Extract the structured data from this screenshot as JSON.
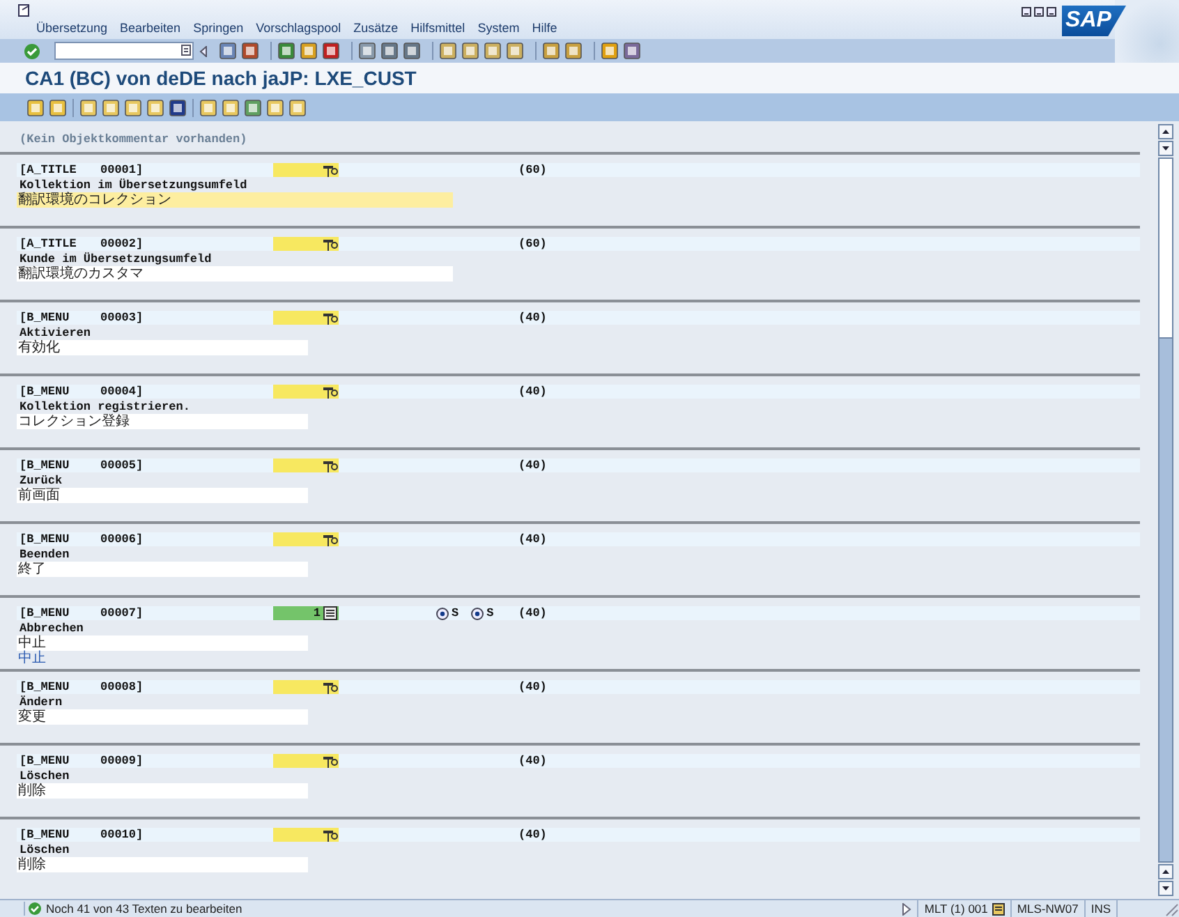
{
  "menu": [
    {
      "label": "Übersetzung"
    },
    {
      "label": "Bearbeiten"
    },
    {
      "label": "Springen"
    },
    {
      "label": "Vorschlagspool"
    },
    {
      "label": "Zusätze"
    },
    {
      "label": "Hilfsmittel"
    },
    {
      "label": "System"
    },
    {
      "label": "Hilfe"
    }
  ],
  "logo": "SAP",
  "title": "CA1 (BC) von deDE nach jaJP: LXE_CUST",
  "object_comment": "(Kein Objektkommentar vorhanden)",
  "entries": [
    {
      "object_type": "[A_TITLE",
      "number": "00001]",
      "length": "(60)",
      "source": "Kollektion im Übersetzungsumfeld",
      "target": "翻訳環境のコレクション",
      "kind": "wide",
      "focused": true
    },
    {
      "object_type": "[A_TITLE",
      "number": "00002]",
      "length": "(60)",
      "source": "Kunde im Übersetzungsumfeld",
      "target": "翻訳環境のカスタマ",
      "kind": "wide",
      "focused": false
    },
    {
      "object_type": "[B_MENU",
      "number": "00003]",
      "length": "(40)",
      "source": "Aktivieren",
      "target": "有効化",
      "kind": "narrow",
      "focused": false
    },
    {
      "object_type": "[B_MENU",
      "number": "00004]",
      "length": "(40)",
      "source": "Kollektion registrieren.",
      "target": "コレクション登録",
      "kind": "narrow",
      "focused": false
    },
    {
      "object_type": "[B_MENU",
      "number": "00005]",
      "length": "(40)",
      "source": "Zurück",
      "target": "前画面",
      "kind": "narrow",
      "focused": false
    },
    {
      "object_type": "[B_MENU",
      "number": "00006]",
      "length": "(40)",
      "source": "Beenden",
      "target": "終了",
      "kind": "narrow",
      "focused": false
    },
    {
      "object_type": "[B_MENU",
      "number": "00007]",
      "length": "(40)",
      "source": "Abbrechen",
      "target": "中止",
      "kind": "narrow",
      "focused": false,
      "proposal_count": "1",
      "options": [
        {
          "label": "S",
          "selected": true
        },
        {
          "label": "S",
          "selected": true
        }
      ],
      "proposal": "中止"
    },
    {
      "object_type": "[B_MENU",
      "number": "00008]",
      "length": "(40)",
      "source": "Ändern",
      "target": "変更",
      "kind": "narrow",
      "focused": false
    },
    {
      "object_type": "[B_MENU",
      "number": "00009]",
      "length": "(40)",
      "source": "Löschen",
      "target": "削除",
      "kind": "narrow",
      "focused": false
    },
    {
      "object_type": "[B_MENU",
      "number": "00010]",
      "length": "(40)",
      "source": "Löschen",
      "target": "削除",
      "kind": "narrow",
      "focused": false
    }
  ],
  "status_bar": {
    "message": "Noch 41 von 43 Texten zu bearbeiten",
    "system": "MLT (1) 001",
    "server": "MLS-NW07",
    "mode": "INS"
  }
}
